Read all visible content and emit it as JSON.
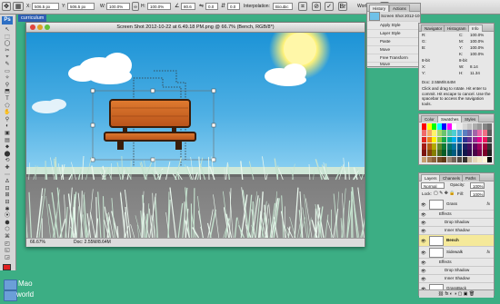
{
  "options_bar": {
    "x_label": "X:",
    "x_value": "506.5 px",
    "y_label": "Y:",
    "y_value": "506.5 px",
    "w_label": "W:",
    "w_value": "100.0%",
    "h_label": "H:",
    "h_value": "100.0%",
    "angle_value": "80.6",
    "h_skew_value": "0.0",
    "v_skew_value": "0.0",
    "interpolation_label": "Bicubic",
    "workspace_label": "Workspa",
    "cancel_glyph": "⊘",
    "commit_glyph": "✓"
  },
  "desktop": {
    "top_folder_label": "curriculum",
    "items": [
      {
        "label": "Mao"
      },
      {
        "label": "world"
      }
    ]
  },
  "toolbox": {
    "tools": [
      "↖",
      "⬚",
      "◯",
      "✂",
      "⌖",
      "✎",
      "▭",
      "✧",
      "⚲",
      "⬒",
      "T",
      "⬠",
      "✋",
      "⚲",
      "◐",
      "▣",
      "▤",
      "⬥",
      "⬤",
      "⟲",
      "✚",
      "⋯",
      "∆",
      "⊡",
      "⊞",
      "⊟",
      "✱",
      "⦿",
      "⬢",
      "⬡",
      "⌘",
      "◰",
      "◱",
      "◲"
    ]
  },
  "document": {
    "title": "Screen Shot 2012-10-22 at 6.49.18 PM.png @ 66.7% (Bench, RGB/8*)",
    "zoom": "66.67%",
    "doc_info": "Doc: 2.55M/8.64M",
    "status_zoom": "66.67%",
    "status_doc": "Doc: 2.55M/8.64M"
  },
  "history_panel": {
    "tabs": [
      "History",
      "Actions"
    ],
    "snapshot_label": "Screen Shot 2012-10-22 at 6.4...",
    "items": [
      "Apply Style",
      "Layer Style",
      "Paste",
      "Move",
      "Free Transform",
      "Move"
    ]
  },
  "info_panel": {
    "tabs": [
      "Navigator",
      "Histogram",
      "Info"
    ],
    "rows": [
      {
        "label": "R:",
        "value": "",
        "label2": "C:",
        "value2": "100.0%"
      },
      {
        "label": "G:",
        "value": "",
        "label2": "M:",
        "value2": "100.0%"
      },
      {
        "label": "B:",
        "value": "",
        "label2": "Y:",
        "value2": "100.0%"
      },
      {
        "label": "",
        "value": "",
        "label2": "K:",
        "value2": "100.0%"
      },
      {
        "label": "8-bit",
        "value": "",
        "label2": "8-bit",
        "value2": ""
      },
      {
        "label": "X:",
        "value": "",
        "label2": "W:",
        "value2": "8.14"
      },
      {
        "label": "Y:",
        "value": "",
        "label2": "H:",
        "value2": "11.34"
      }
    ],
    "doc_line": "Doc: 2.55M/8.64M",
    "hint": "Click and drag to rotate. Hit enter to commit. Hit escape to cancel. Use the spacebar to access the navigation tools."
  },
  "swatches_panel": {
    "tabs": [
      "Color",
      "Swatches",
      "Styles"
    ],
    "colors": [
      "#ff0000",
      "#ffff00",
      "#00ff00",
      "#00ffff",
      "#0000ff",
      "#ff00ff",
      "#ffffff",
      "#ebebeb",
      "#d6d6d6",
      "#c2c2c2",
      "#adadad",
      "#999999",
      "#858585",
      "#707070",
      "#f06a6a",
      "#f3ac67",
      "#fff36b",
      "#a7d96b",
      "#6cc36e",
      "#58c7a5",
      "#4ecfd3",
      "#53a9d9",
      "#5b7ec0",
      "#6e62a8",
      "#a264a8",
      "#e96aa6",
      "#ef6e84",
      "#5c5c5c",
      "#e0231f",
      "#ed7d1d",
      "#fff200",
      "#8cc63f",
      "#19a94b",
      "#00a99d",
      "#00aeef",
      "#0072bc",
      "#2e3192",
      "#662d91",
      "#92278f",
      "#ec008c",
      "#ed145b",
      "#474747",
      "#a31b17",
      "#b35d12",
      "#b3aa00",
      "#5f8a28",
      "#0d7a35",
      "#00746c",
      "#0076a3",
      "#004a80",
      "#1b1e63",
      "#440e62",
      "#630460",
      "#a3005f",
      "#9e0039",
      "#333333",
      "#7a130f",
      "#85450c",
      "#857f00",
      "#476a1e",
      "#075c27",
      "#005952",
      "#005b7f",
      "#003663",
      "#13154a",
      "#32094a",
      "#4a0348",
      "#7a0047",
      "#790027",
      "#1e1e1e",
      "#c69c6d",
      "#a67c52",
      "#8c6239",
      "#754c24",
      "#603913",
      "#998675",
      "#736357",
      "#534741",
      "#362f2d",
      "#c7b299",
      "#e6d6b8",
      "#f5e9c8",
      "#fff5d6",
      "#000000"
    ]
  },
  "layers_panel": {
    "tabs": [
      "Layers",
      "Channels",
      "Paths"
    ],
    "blend_mode": "Normal",
    "opacity_label": "Opacity:",
    "opacity_value": "100%",
    "lock_label": "Lock:",
    "fill_label": "Fill:",
    "fill_value": "100%",
    "layers": [
      {
        "name": "Grass",
        "type": "layer",
        "fx": "fx",
        "selected": false
      },
      {
        "name": "Effects",
        "type": "effect-header",
        "selected": false
      },
      {
        "name": "Drop Shadow",
        "type": "effect",
        "selected": false
      },
      {
        "name": "Inner Shadow",
        "type": "effect",
        "selected": false
      },
      {
        "name": "Bench",
        "type": "layer",
        "fx": "",
        "selected": true
      },
      {
        "name": "Sidewalk",
        "type": "layer",
        "fx": "fx",
        "selected": false
      },
      {
        "name": "Effects",
        "type": "effect-header",
        "selected": false
      },
      {
        "name": "Drop Shadow",
        "type": "effect",
        "selected": false
      },
      {
        "name": "Inner Shadow",
        "type": "effect",
        "selected": false
      },
      {
        "name": "GrassBack",
        "type": "layer",
        "fx": "",
        "selected": false
      }
    ]
  },
  "colors": {
    "desktop_bg": "#3cae84",
    "selected_layer": "#f5e99a",
    "foreground_swatch": "#e02020",
    "background_swatch": "#ffffff"
  }
}
